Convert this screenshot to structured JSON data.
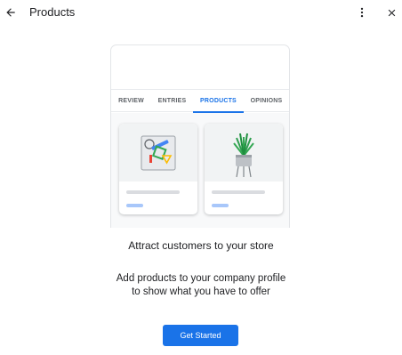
{
  "header": {
    "title": "Products",
    "back_icon": "arrow-back-icon",
    "more_icon": "more-vert-icon",
    "close_icon": "close-icon"
  },
  "preview": {
    "tabs": [
      {
        "label": "REVIEW",
        "active": false
      },
      {
        "label": "ENTRIES",
        "active": false
      },
      {
        "label": "PRODUCTS",
        "active": true
      },
      {
        "label": "OPINIONS",
        "active": false
      }
    ],
    "cards": [
      {
        "illustration": "shapes-icon"
      },
      {
        "illustration": "potted-plant-icon"
      }
    ]
  },
  "content": {
    "heading": "Attract customers to your store",
    "description_line1": "Add products to your company profile",
    "description_line2": "to show what you have to offer"
  },
  "cta": {
    "label": "Get Started"
  },
  "colors": {
    "accent": "#1a73e8",
    "text": "#202124"
  }
}
